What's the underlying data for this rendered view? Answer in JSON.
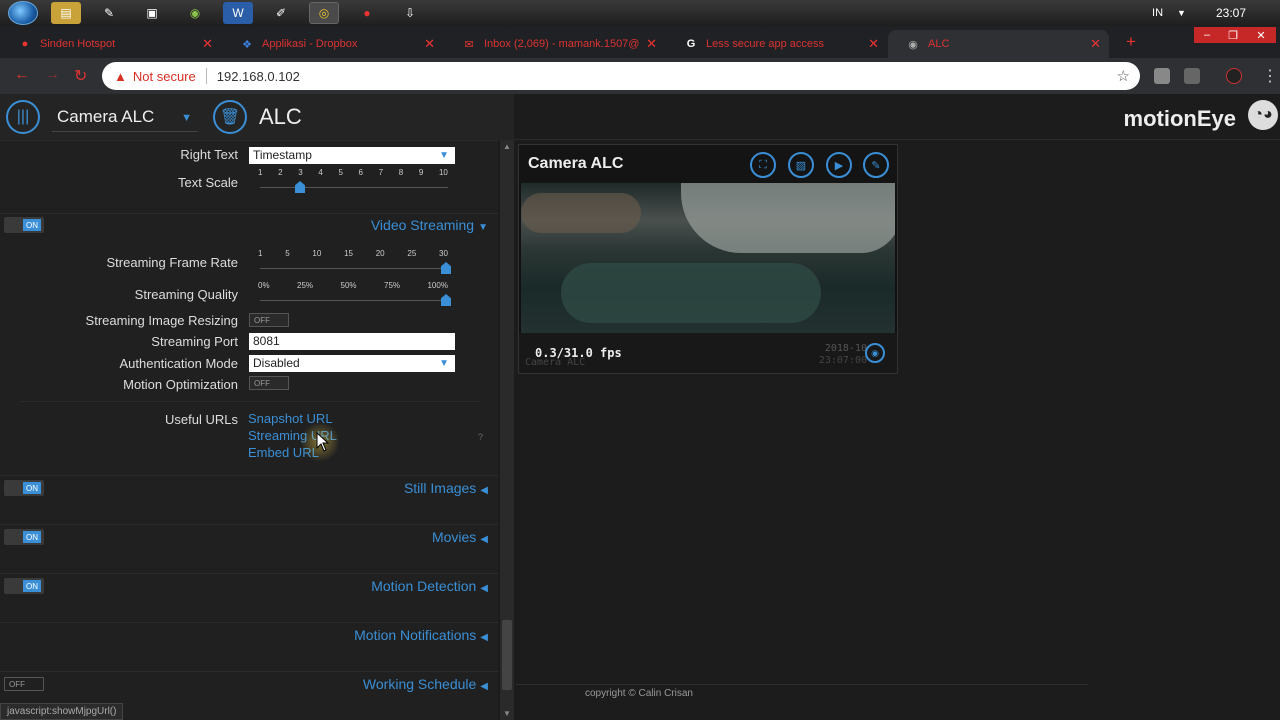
{
  "taskbar": {
    "language": "IN",
    "clock": "23:07"
  },
  "tabs": [
    {
      "title": "Sinden Hotspot",
      "icon": "red-circle-icon",
      "active": false
    },
    {
      "title": "Applikasi - Dropbox",
      "icon": "dropbox-icon",
      "active": false
    },
    {
      "title": "Inbox (2,069) - mamank.1507@",
      "icon": "gmail-icon",
      "active": false
    },
    {
      "title": "Less secure app access",
      "icon": "google-icon",
      "active": false
    },
    {
      "title": "ALC",
      "icon": "motioneye-icon",
      "active": true
    }
  ],
  "addressbar": {
    "security_label": "Not secure",
    "url": "192.168.0.102"
  },
  "header": {
    "camera_select": "Camera ALC",
    "title": "ALC",
    "brand": "motionEye"
  },
  "settings": {
    "right_text": {
      "label": "Right Text",
      "value": "Timestamp"
    },
    "text_scale": {
      "label": "Text Scale",
      "ticks": [
        "1",
        "2",
        "3",
        "4",
        "5",
        "6",
        "7",
        "8",
        "9",
        "10"
      ],
      "value": 3
    },
    "video_streaming": {
      "title": "Video Streaming",
      "toggle": "ON"
    },
    "frame_rate": {
      "label": "Streaming Frame Rate",
      "ticks": [
        "1",
        "5",
        "10",
        "15",
        "20",
        "25",
        "30"
      ],
      "value": 30
    },
    "quality": {
      "label": "Streaming Quality",
      "ticks": [
        "0%",
        "25%",
        "50%",
        "75%",
        "100%"
      ],
      "value": 100
    },
    "image_resizing": {
      "label": "Streaming Image Resizing",
      "toggle": "OFF"
    },
    "port": {
      "label": "Streaming Port",
      "value": "8081"
    },
    "auth_mode": {
      "label": "Authentication Mode",
      "value": "Disabled"
    },
    "motion_opt": {
      "label": "Motion Optimization",
      "toggle": "OFF"
    },
    "useful_urls": {
      "label": "Useful URLs",
      "links": [
        "Snapshot URL",
        "Streaming URL",
        "Embed URL"
      ],
      "help": "?"
    },
    "still_images": {
      "title": "Still Images",
      "toggle": "ON"
    },
    "movies": {
      "title": "Movies",
      "toggle": "ON"
    },
    "motion_detection": {
      "title": "Motion Detection",
      "toggle": "ON"
    },
    "motion_notifications": {
      "title": "Motion Notifications"
    },
    "working_schedule": {
      "title": "Working Schedule",
      "toggle": "OFF"
    }
  },
  "status_url": "javascript:showMjpgUrl()",
  "camera": {
    "name": "Camera ALC",
    "fps": "0.3/31.0 fps",
    "osd_date": "2018-10",
    "osd_name": "Camera ALC",
    "osd_time": "23:07:00"
  },
  "footer": {
    "copyright": "copyright © Calin Crisan"
  },
  "colors": {
    "accent": "#3a8fd6",
    "background": "#1c1c1c",
    "panel": "#202020"
  }
}
